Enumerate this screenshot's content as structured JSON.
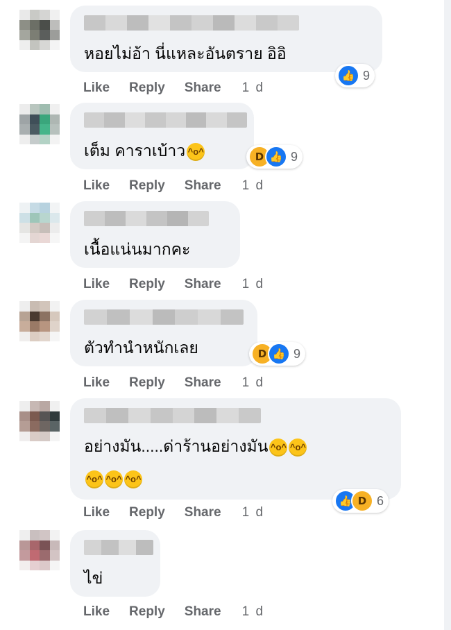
{
  "actions": {
    "like": "Like",
    "reply": "Reply",
    "share": "Share"
  },
  "comments": [
    {
      "text": "หอยไม่อ้า นี่แหละอันตราย อิอิ",
      "reaction_count": "9",
      "reactions": [
        "like"
      ],
      "time": "1 d"
    },
    {
      "text": "เต็ม คาราเบ้าว",
      "inline_emoji": [
        "laughing"
      ],
      "reaction_count": "9",
      "reactions": [
        "haha",
        "like"
      ],
      "time": "1 d"
    },
    {
      "text": "เนื้อแน่นมากคะ",
      "time": "1 d"
    },
    {
      "text": "ตัวทำนำหนักเลย",
      "reaction_count": "9",
      "reactions": [
        "haha",
        "like"
      ],
      "time": "1 d"
    },
    {
      "text": "อย่างมัน.....ด่าร้านอย่างมัน",
      "inline_emoji": [
        "laughing",
        "laughing"
      ],
      "text_line2_emoji": [
        "laughing",
        "laughing",
        "laughing"
      ],
      "reaction_count": "6",
      "reactions": [
        "like",
        "haha"
      ],
      "time": "1 d"
    },
    {
      "text": "ไข่",
      "time": "1 d"
    }
  ],
  "icons": {
    "like": "thumbs-up-icon",
    "haha": "laughing-face-icon",
    "emoji": "tears-of-joy-emoji"
  },
  "colors": {
    "bubble": "#f0f2f5",
    "like_blue": "#1877f2",
    "haha_yellow": "#f7b125",
    "meta_gray": "#65676b"
  }
}
